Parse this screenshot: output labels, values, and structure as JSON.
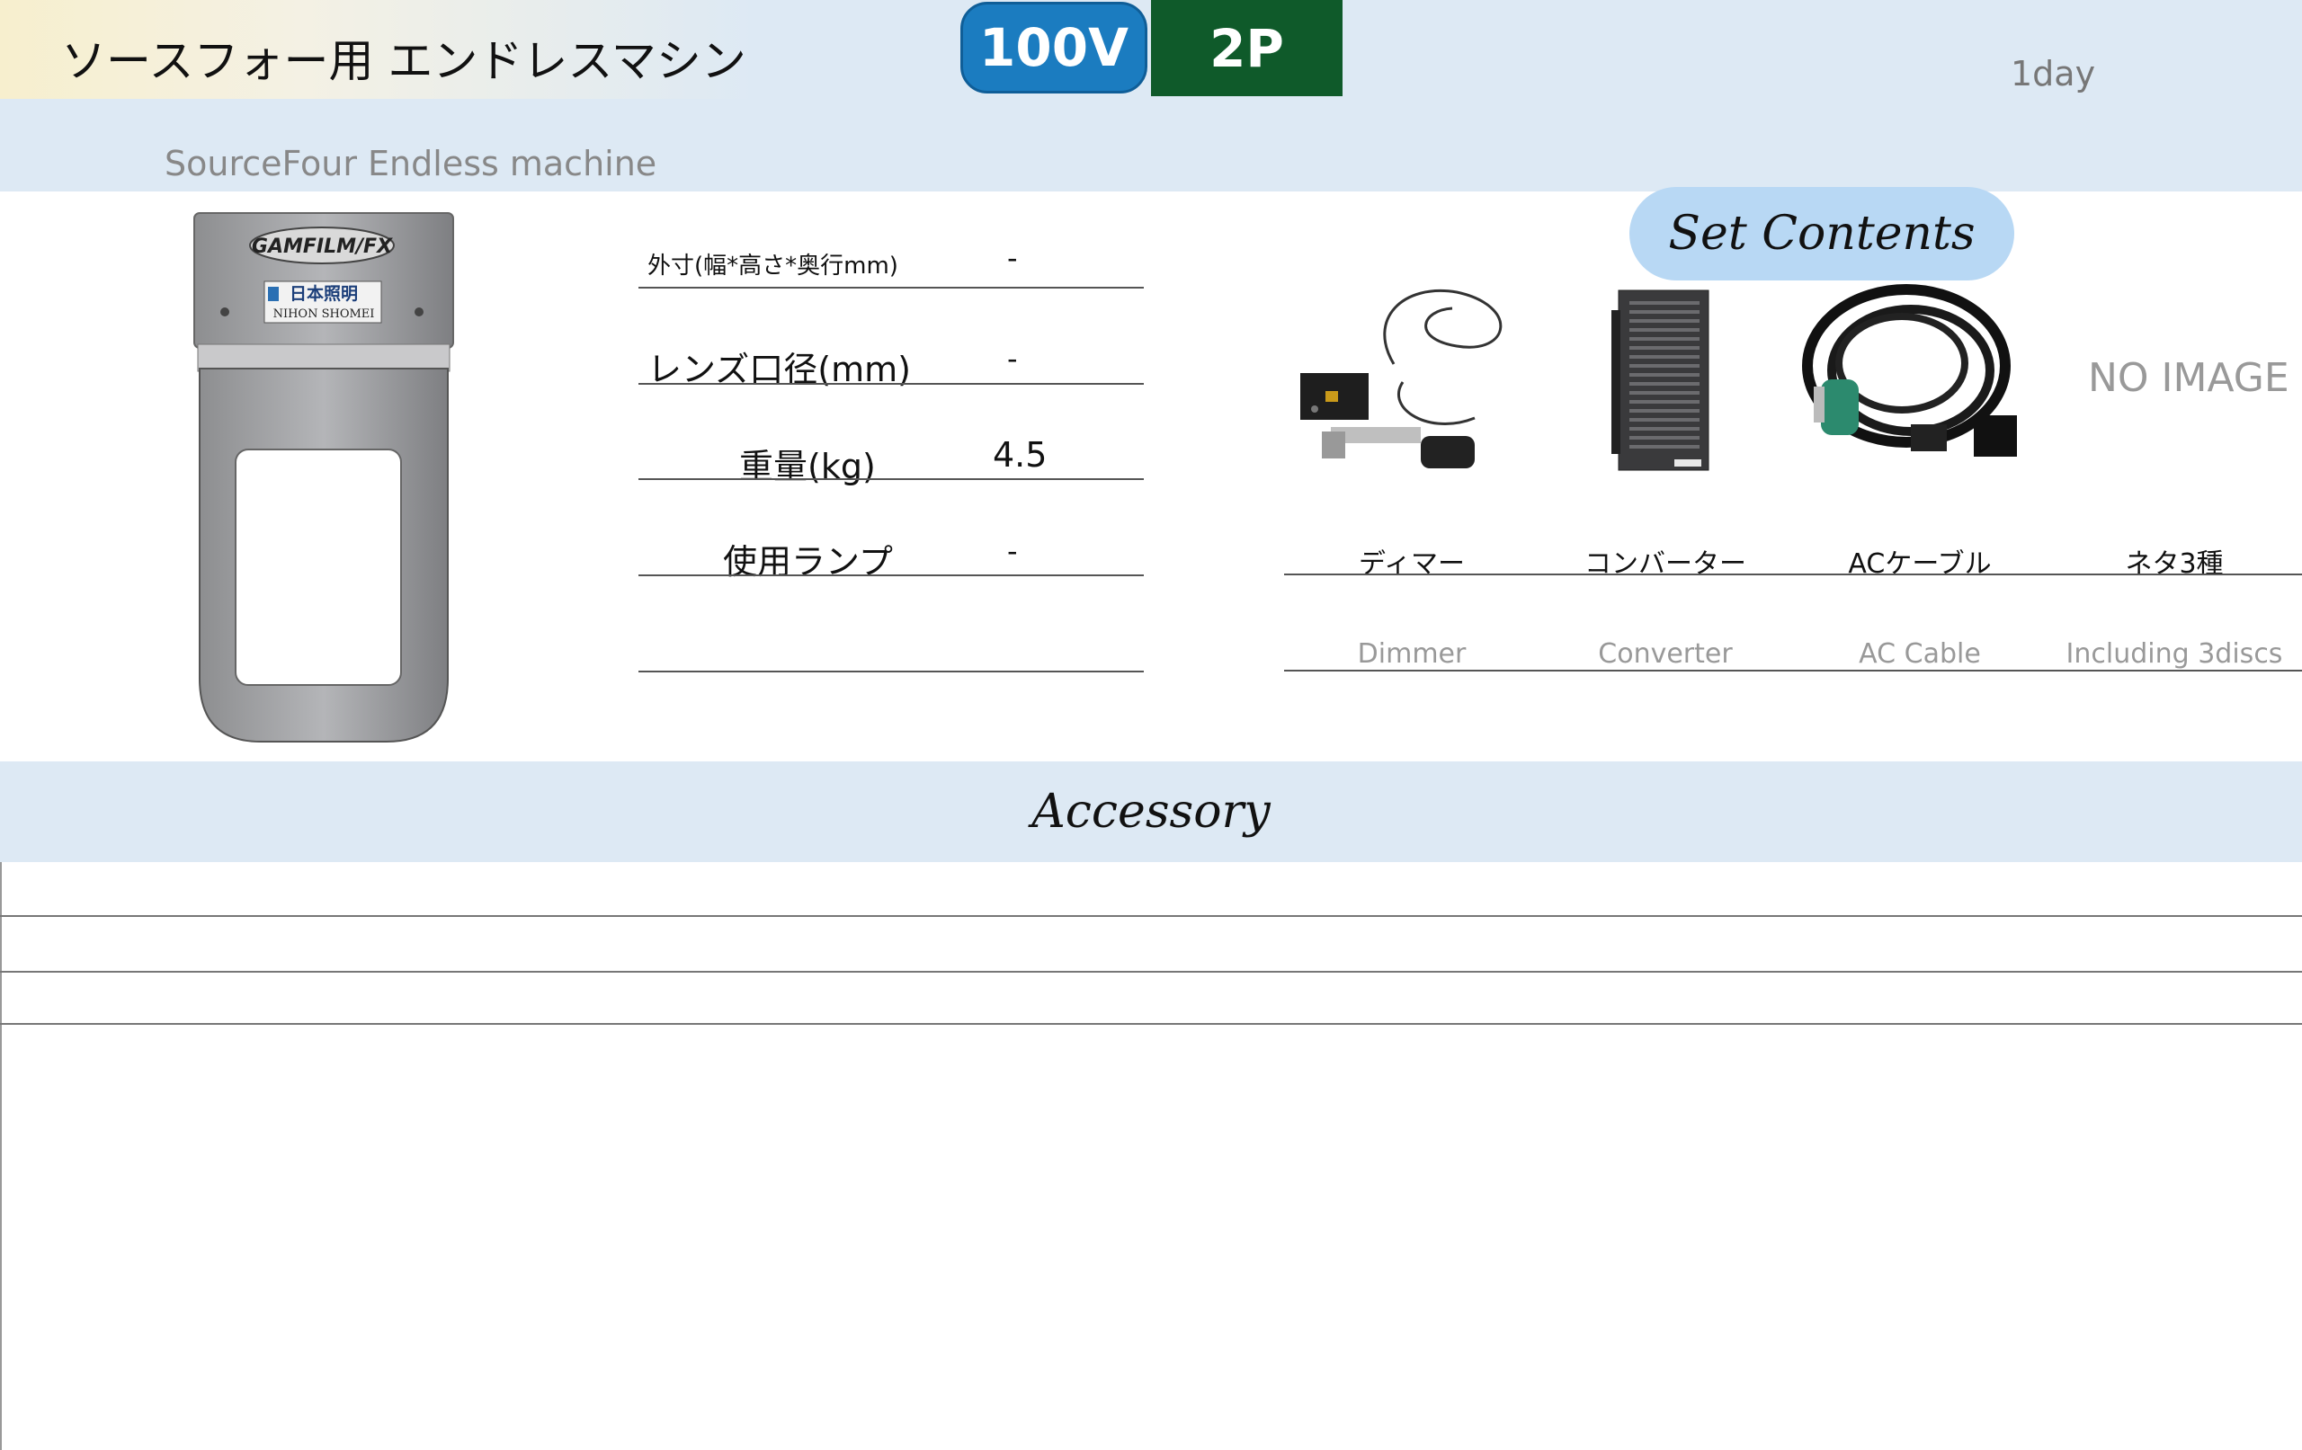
{
  "header": {
    "title": "ソースフォー用 エンドレスマシン",
    "subtitle": "SourceFour Endless machine",
    "voltage_badge": "100V",
    "plug_badge": "2P",
    "rental_period": "1day"
  },
  "product_photo": {
    "brand_text": "GAMFILM/FX",
    "maker_text_jp": "日本照明",
    "maker_text_en": "NIHON SHOMEI"
  },
  "specs": [
    {
      "label": "外寸(幅*高さ*奥行mm)",
      "value": "-"
    },
    {
      "label": "レンズ口径(mm)",
      "value": "-"
    },
    {
      "label": "重量(kg)",
      "value": "4.5"
    },
    {
      "label": "使用ランプ",
      "value": "-"
    }
  ],
  "set_contents": {
    "title": "Set Contents",
    "items": [
      {
        "name_jp": "ディマー",
        "name_en": "Dimmer",
        "icon": "dimmer-icon"
      },
      {
        "name_jp": "コンバーター",
        "name_en": "Converter",
        "icon": "converter-icon"
      },
      {
        "name_jp": "ACケーブル",
        "name_en": "AC Cable",
        "icon": "ac-cable-icon"
      },
      {
        "name_jp": "ネタ3種",
        "name_en": "Including 3discs",
        "icon": "no-image"
      }
    ],
    "no_image_text": "NO IMAGE"
  },
  "accessory": {
    "title": "Accessory"
  },
  "colors": {
    "header_band": "#dde9f4",
    "voltage_badge": "#1b7cc0",
    "plug_badge": "#0f5a2a",
    "set_pill": "#b8d8f4"
  }
}
